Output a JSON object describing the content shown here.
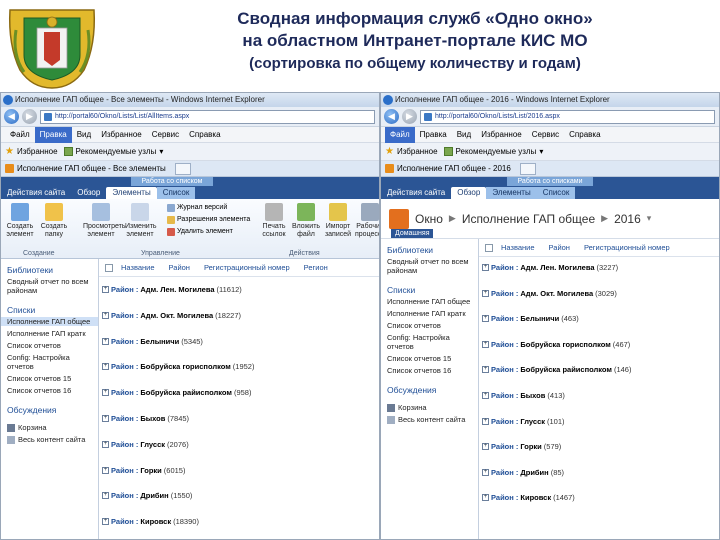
{
  "slide": {
    "title_line1": "Сводная информация служб «Одно окно»",
    "title_line2": "на областном Интранет-портале КИС МО",
    "title_line3": "(сортировка по общему количеству и годам)"
  },
  "colors": {
    "title": "#1e2a5a",
    "ribbon": "#2b5595",
    "link": "#1f4e96",
    "menu_highlight": "#3a6bc9"
  },
  "left": {
    "window_title": "Исполнение ГАП общее - Все элементы - Windows Internet Explorer",
    "address": "http://portal60/Okno/Lists/List/AllItems.aspx",
    "menu": [
      "Файл",
      "Правка",
      "Вид",
      "Избранное",
      "Сервис",
      "Справка"
    ],
    "favorites_label": "Избранное",
    "suggested_sites": "Рекомендуемые узлы",
    "tab_title": "Исполнение ГАП общее - Все элементы",
    "ribbon_context": "Работа со списком",
    "ribbon_tabs": [
      "Действия сайта",
      "Обзор",
      "Элементы",
      "Список"
    ],
    "ribbon": {
      "create_item": "Создать элемент",
      "create_folder": "Создать папку",
      "view_item": "Просмотреть элемент",
      "edit_item": "Изменить элемент",
      "version_log": "Журнал версий",
      "permissions": "Разрешения элемента",
      "delete_item": "Удалить элемент",
      "print_links": "Печать ссылок",
      "embed": "Вложить файл",
      "import": "Импорт записей",
      "workflows": "Рабочие процессы",
      "group_create": "Создание",
      "group_manage": "Управление",
      "group_actions": "Действия"
    },
    "sidebar": {
      "libraries_heading": "Библиотеки",
      "libraries": [
        "Сводный отчет по всем районам"
      ],
      "lists_heading": "Списки",
      "lists": [
        "Исполнение ГАП общее",
        "Исполнение ГАП кратк",
        "Список отчетов",
        "Config: Настройка отчетов",
        "Список отчетов 15",
        "Список отчетов 16"
      ],
      "discussions_heading": "Обсуждения",
      "recycle_bin": "Корзина",
      "all_content": "Весь контент сайта"
    },
    "columns": [
      "Название",
      "Район",
      "Регистрационный номер",
      "Регион"
    ],
    "group_label": "Район :",
    "groups": [
      {
        "name": "Адм. Лен. Могилева",
        "count": "(11612)"
      },
      {
        "name": "Адм. Окт. Могилева",
        "count": "(18227)"
      },
      {
        "name": "Белыничи",
        "count": "(5345)"
      },
      {
        "name": "Бобруйска горисполком",
        "count": "(1952)"
      },
      {
        "name": "Бобруйска райисполком",
        "count": "(958)"
      },
      {
        "name": "Быхов",
        "count": "(7845)"
      },
      {
        "name": "Глусск",
        "count": "(2076)"
      },
      {
        "name": "Горки",
        "count": "(6015)"
      },
      {
        "name": "Дрибин",
        "count": "(1550)"
      },
      {
        "name": "Кировск",
        "count": "(18390)"
      }
    ]
  },
  "right": {
    "window_title": "Исполнение ГАП общее - 2016 - Windows Internet Explorer",
    "address": "http://portal60/Okno/Lists/List/2016.aspx",
    "menu": [
      "Файл",
      "Правка",
      "Вид",
      "Избранное",
      "Сервис",
      "Справка"
    ],
    "favorites_label": "Избранное",
    "suggested_sites": "Рекомендуемые узлы",
    "tab_title": "Исполнение ГАП общее - 2016",
    "ribbon_context": "Работа со списками",
    "ribbon_tabs": [
      "Действия сайта",
      "Обзор",
      "Элементы",
      "Список"
    ],
    "breadcrumb": [
      "Окно",
      "Исполнение ГАП общее",
      "2016"
    ],
    "breadcrumb_sub": "Домашняя",
    "sidebar": {
      "libraries_heading": "Библиотеки",
      "libraries": [
        "Сводный отчет по всем районам"
      ],
      "lists_heading": "Списки",
      "lists": [
        "Исполнение ГАП общее",
        "Исполнение ГАП кратк",
        "Список отчетов",
        "Config: Настройка отчетов",
        "Список отчетов 15",
        "Список отчетов 16"
      ],
      "discussions_heading": "Обсуждения",
      "recycle_bin": "Корзина",
      "all_content": "Весь контент сайта"
    },
    "columns": [
      "Название",
      "Район",
      "Регистрационный номер"
    ],
    "group_label": "Район :",
    "groups": [
      {
        "name": "Адм. Лен. Могилева",
        "count": "(3227)"
      },
      {
        "name": "Адм. Окт. Могилева",
        "count": "(3029)"
      },
      {
        "name": "Белыничи",
        "count": "(463)"
      },
      {
        "name": "Бобруйска горисполком",
        "count": "(467)"
      },
      {
        "name": "Бобруйска райисполком",
        "count": "(146)"
      },
      {
        "name": "Быхов",
        "count": "(413)"
      },
      {
        "name": "Глусск",
        "count": "(101)"
      },
      {
        "name": "Горки",
        "count": "(579)"
      },
      {
        "name": "Дрибин",
        "count": "(85)"
      },
      {
        "name": "Кировск",
        "count": "(1467)"
      }
    ]
  }
}
